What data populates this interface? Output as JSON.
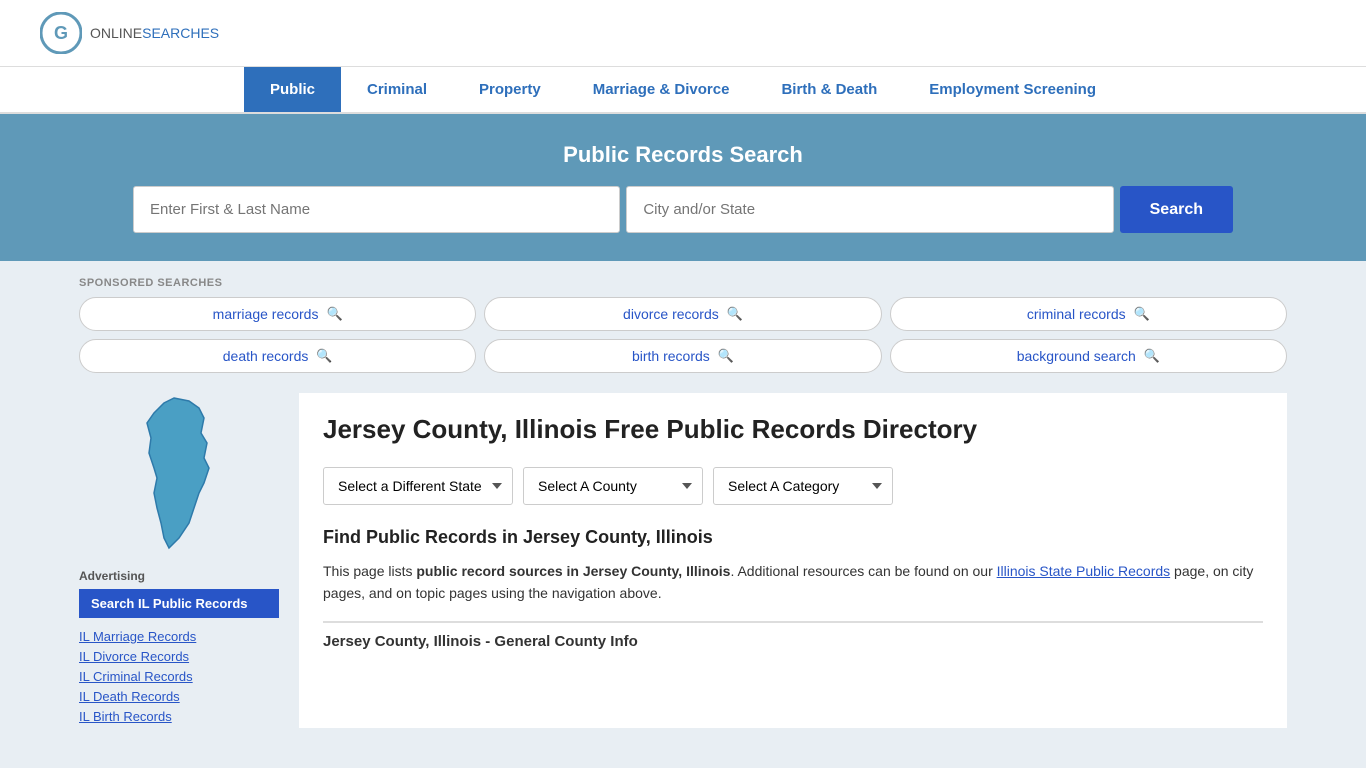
{
  "header": {
    "logo_online": "ONLINE",
    "logo_searches": "SEARCHES"
  },
  "nav": {
    "items": [
      {
        "label": "Public",
        "active": true
      },
      {
        "label": "Criminal",
        "active": false
      },
      {
        "label": "Property",
        "active": false
      },
      {
        "label": "Marriage & Divorce",
        "active": false
      },
      {
        "label": "Birth & Death",
        "active": false
      },
      {
        "label": "Employment Screening",
        "active": false
      }
    ]
  },
  "hero": {
    "title": "Public Records Search",
    "name_placeholder": "Enter First & Last Name",
    "location_placeholder": "City and/or State",
    "search_button": "Search"
  },
  "sponsored": {
    "label": "SPONSORED SEARCHES",
    "items": [
      {
        "label": "marriage records"
      },
      {
        "label": "divorce records"
      },
      {
        "label": "criminal records"
      },
      {
        "label": "death records"
      },
      {
        "label": "birth records"
      },
      {
        "label": "background search"
      }
    ]
  },
  "sidebar": {
    "advertising_label": "Advertising",
    "search_il_btn": "Search IL Public Records",
    "links": [
      {
        "label": "IL Marriage Records"
      },
      {
        "label": "IL Divorce Records"
      },
      {
        "label": "IL Criminal Records"
      },
      {
        "label": "IL Death Records"
      },
      {
        "label": "IL Birth Records"
      }
    ]
  },
  "main": {
    "page_title": "Jersey County, Illinois Free Public Records Directory",
    "dropdowns": {
      "state": "Select a Different State",
      "county": "Select A County",
      "category": "Select A Category"
    },
    "find_title": "Find Public Records in Jersey County, Illinois",
    "description_part1": "This page lists ",
    "description_bold": "public record sources in Jersey County, Illinois",
    "description_part2": ". Additional resources can be found on our ",
    "description_link": "Illinois State Public Records",
    "description_part3": " page, on city pages, and on topic pages using the navigation above.",
    "county_info_heading": "Jersey County, Illinois - General County Info"
  }
}
